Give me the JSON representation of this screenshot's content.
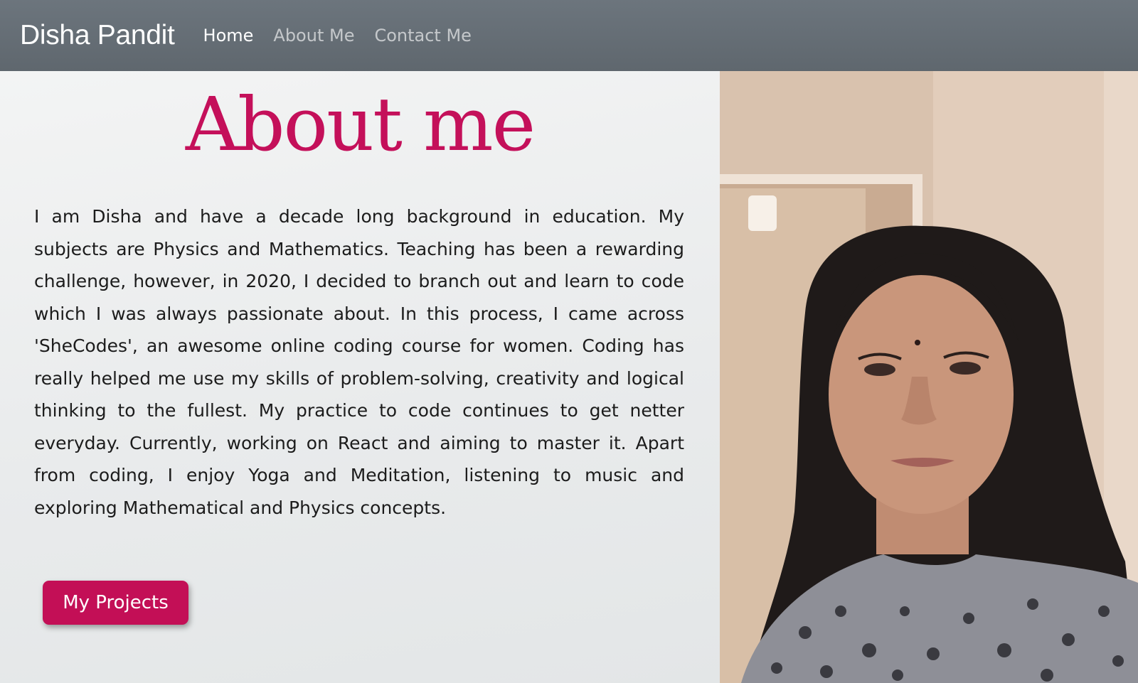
{
  "navbar": {
    "brand": "Disha Pandit",
    "links": [
      {
        "label": "Home",
        "active": true
      },
      {
        "label": "About Me",
        "active": false
      },
      {
        "label": "Contact Me",
        "active": false
      }
    ]
  },
  "main": {
    "title": "About me",
    "bio": "I am Disha and have a decade long background in education. My subjects are Physics and Mathematics. Teaching has been a rewarding challenge, however, in 2020, I decided to branch out and learn to code which I was always passionate about. In this process, I came across 'SheCodes', an awesome online coding course for women. Coding has really helped me use my skills of problem-solving, creativity and logical thinking to the fullest. My practice to code continues to get netter everyday. Currently, working on React and aiming to master it. Apart from coding, I enjoy Yoga and Meditation, listening to music and exploring Mathematical and Physics concepts.",
    "projects_button": "My Projects"
  },
  "colors": {
    "navbar": "#6c757d",
    "accent": "#c4105a",
    "text": "#1c1c1c"
  }
}
